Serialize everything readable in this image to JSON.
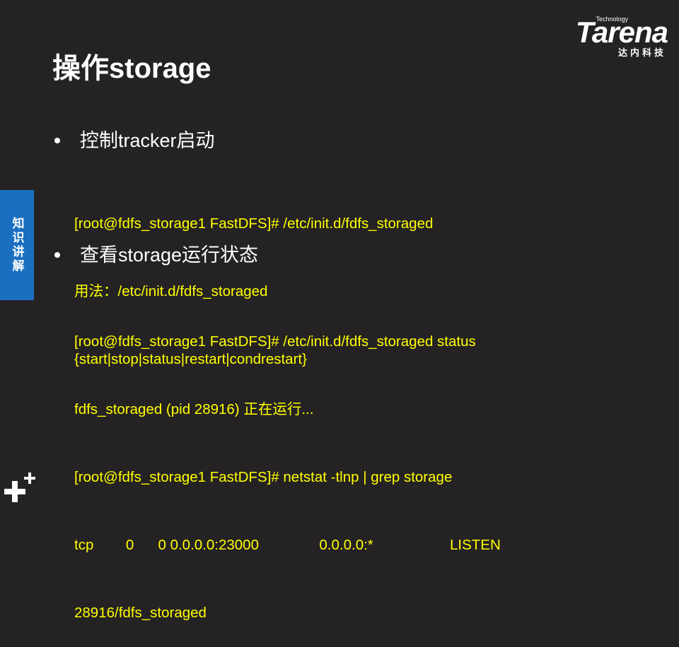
{
  "logo": {
    "tech": "Technology",
    "word": "Tarena",
    "cn": "达内科技"
  },
  "title": "操作storage",
  "side_tab": "知识讲解",
  "bullets": [
    {
      "label": "控制tracker启动",
      "lines": [
        "[root@fdfs_storage1 FastDFS]# /etc/init.d/fdfs_storaged",
        "用法：/etc/init.d/fdfs_storaged",
        "{start|stop|status|restart|condrestart}"
      ]
    },
    {
      "label": "查看storage运行状态",
      "lines": [
        "[root@fdfs_storage1 FastDFS]# /etc/init.d/fdfs_storaged status",
        "fdfs_storaged (pid 28916) 正在运行...",
        "[root@fdfs_storage1 FastDFS]# netstat -tlnp | grep storage",
        "tcp        0      0 0.0.0.0:23000               0.0.0.0:*                   LISTEN",
        "28916/fdfs_storaged"
      ]
    }
  ],
  "colors": {
    "background": "#252223",
    "code": "#ffff00",
    "side_tab": "#1b6fc0"
  },
  "icons": {
    "bottom_left": "plus-plus-icon"
  }
}
